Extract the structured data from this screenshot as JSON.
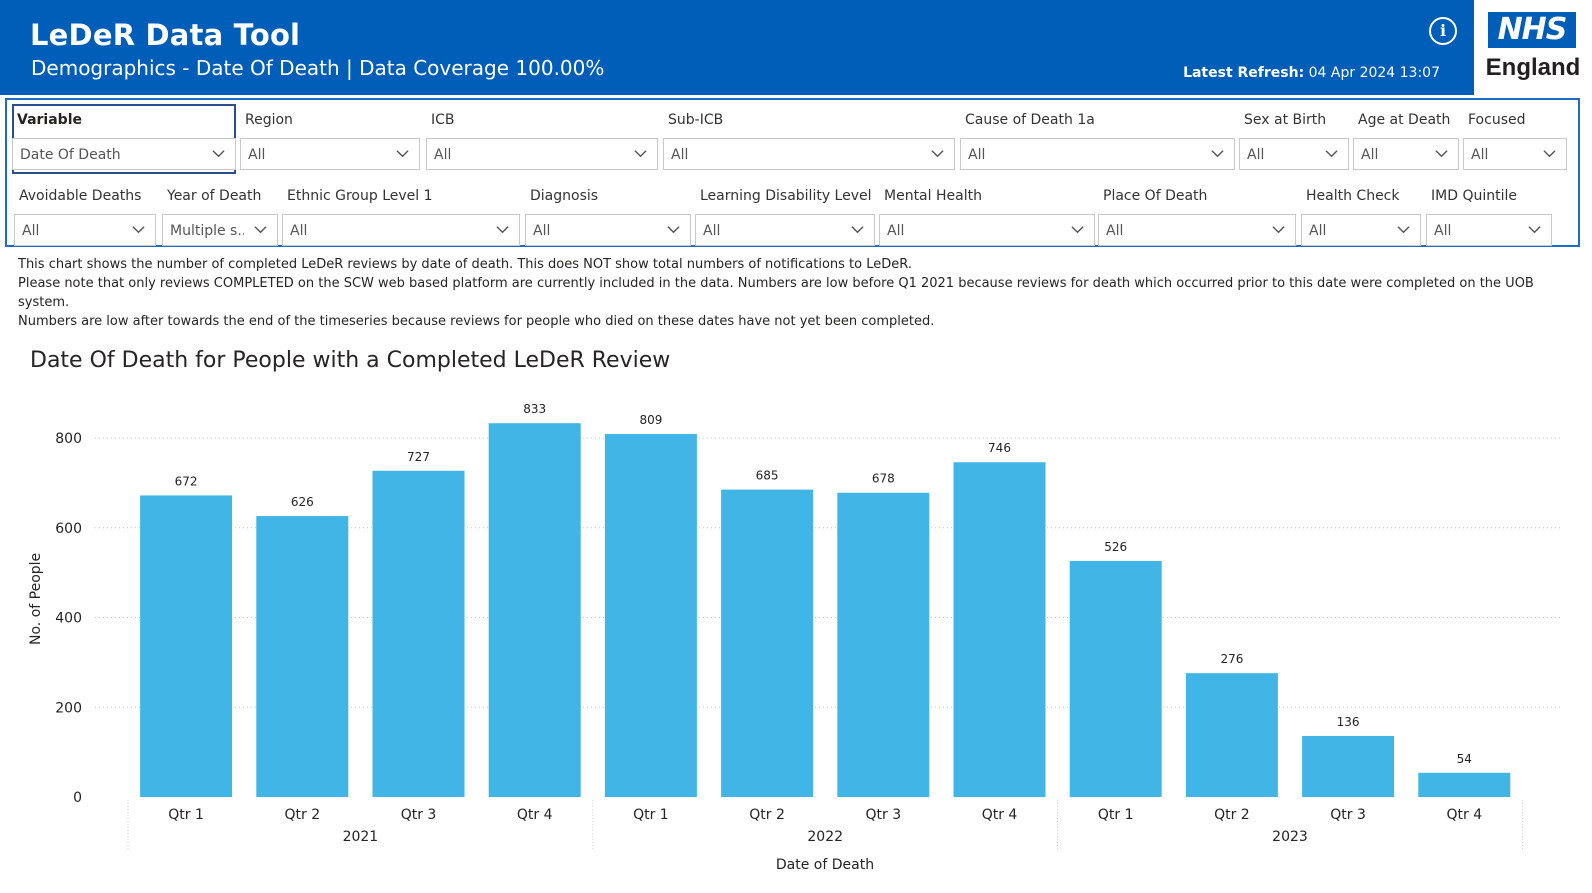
{
  "header": {
    "title": "LeDeR Data Tool",
    "subtitle": "Demographics - Date Of Death | Data Coverage 100.00%",
    "refresh_label": "Latest Refresh:",
    "refresh_value": "04 Apr 2024 13:07",
    "info_icon": "info-icon",
    "brand": {
      "logo_text": "NHS",
      "org": "England",
      "color": "#005eb8"
    }
  },
  "filters": {
    "row1": [
      {
        "label": "Variable",
        "value": "Date Of Death"
      },
      {
        "label": "Region",
        "value": "All"
      },
      {
        "label": "ICB",
        "value": "All"
      },
      {
        "label": "Sub-ICB",
        "value": "All"
      },
      {
        "label": "Cause of Death 1a",
        "value": "All"
      },
      {
        "label": "Sex at Birth",
        "value": "All"
      },
      {
        "label": "Age at Death",
        "value": "All"
      },
      {
        "label": "Focused",
        "value": "All"
      }
    ],
    "row2": [
      {
        "label": "Avoidable Deaths",
        "value": "All"
      },
      {
        "label": "Year of Death",
        "value": "Multiple s..."
      },
      {
        "label": "Ethnic Group Level 1",
        "value": "All"
      },
      {
        "label": "Diagnosis",
        "value": "All"
      },
      {
        "label": "Learning Disability Level",
        "value": "All"
      },
      {
        "label": "Mental Health",
        "value": "All"
      },
      {
        "label": "Place Of Death",
        "value": "All"
      },
      {
        "label": "Health Check",
        "value": "All"
      },
      {
        "label": "IMD Quintile",
        "value": "All"
      }
    ]
  },
  "notes": [
    "This chart shows the number of completed LeDeR reviews by date of death. This does NOT show total numbers of notifications to LeDeR.",
    "Please note that only reviews COMPLETED on the SCW web based platform are currently included in the data. Numbers are low before Q1 2021 because reviews for death which occurred prior to this date were completed on the UOB system.",
    "Numbers are low after towards the end of the timeseries because reviews for people who died on these dates have not yet been completed."
  ],
  "chart_data": {
    "type": "bar",
    "title": "Date Of Death for People with a Completed LeDeR Review",
    "xlabel": "Date of Death",
    "ylabel": "No. of People",
    "categories": [
      "Qtr 1",
      "Qtr 2",
      "Qtr 3",
      "Qtr 4",
      "Qtr 1",
      "Qtr 2",
      "Qtr 3",
      "Qtr 4",
      "Qtr 1",
      "Qtr 2",
      "Qtr 3",
      "Qtr 4"
    ],
    "groups": [
      {
        "label": "2021",
        "count": 4
      },
      {
        "label": "2022",
        "count": 4
      },
      {
        "label": "2023",
        "count": 4
      }
    ],
    "values": [
      672,
      626,
      727,
      833,
      809,
      685,
      678,
      746,
      526,
      276,
      136,
      54
    ],
    "yticks": [
      0,
      200,
      400,
      600,
      800
    ],
    "ylim": [
      0,
      833
    ],
    "grid": true,
    "bar_color": "#41b6e6"
  }
}
